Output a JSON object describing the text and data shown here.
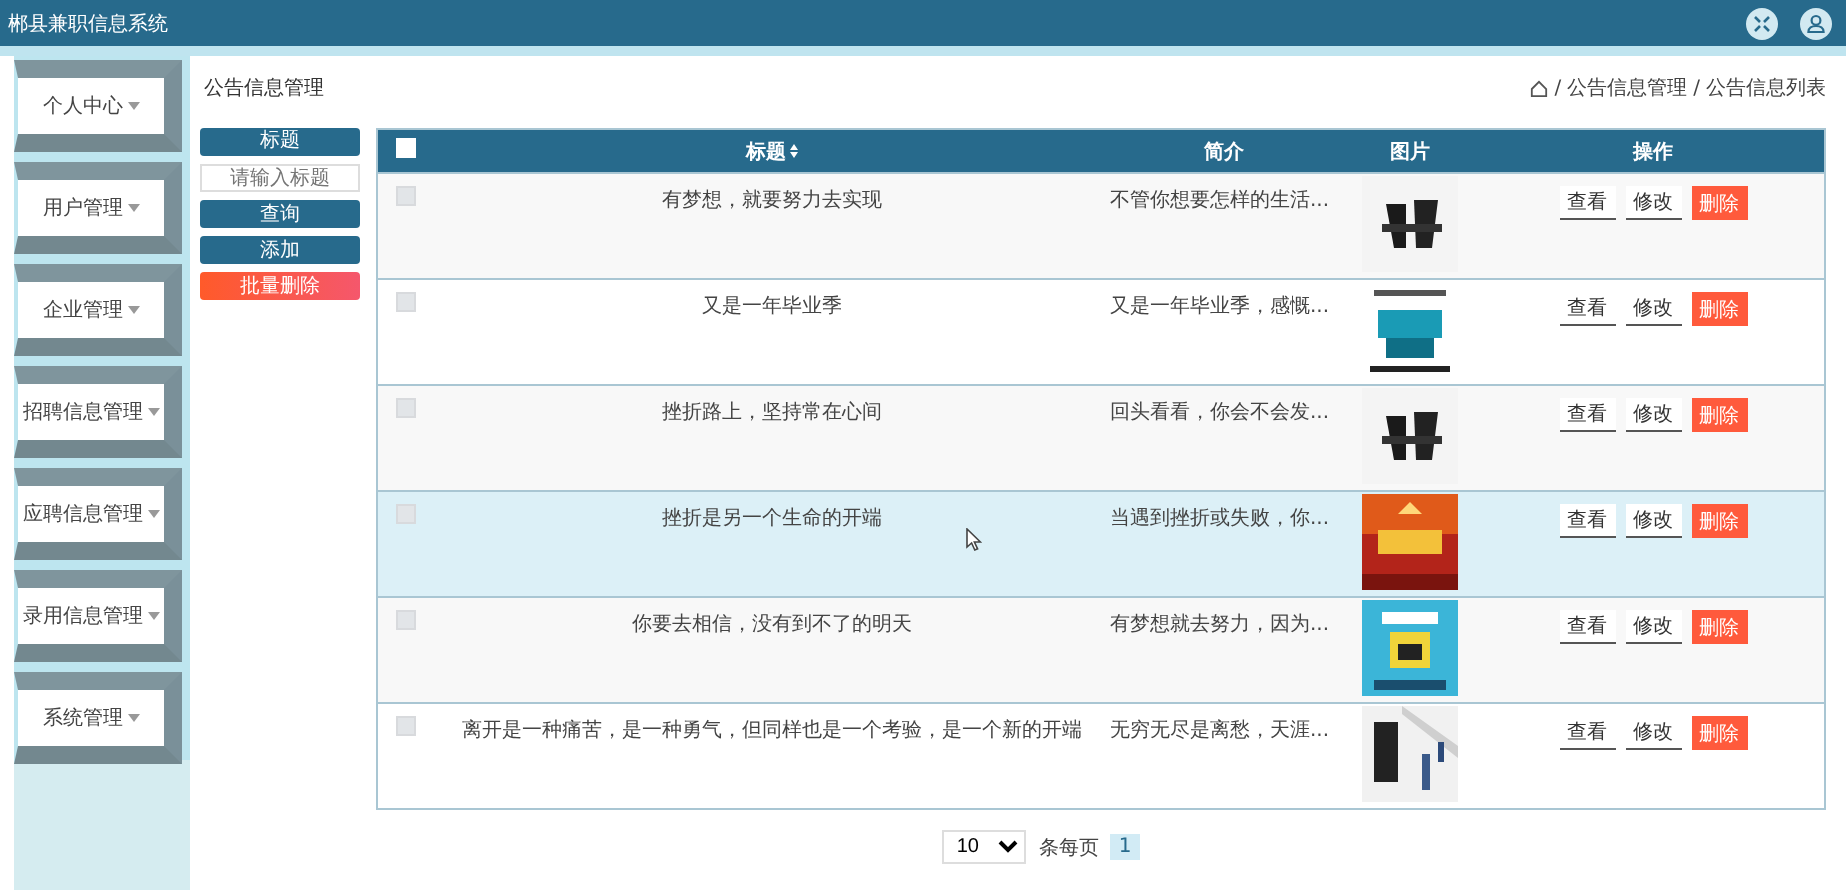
{
  "window": {
    "title": "郴县兼职信息系统"
  },
  "sidebar": {
    "items": [
      {
        "label": "个人中心"
      },
      {
        "label": "用户管理"
      },
      {
        "label": "企业管理"
      },
      {
        "label": "招聘信息管理"
      },
      {
        "label": "应聘信息管理"
      },
      {
        "label": "录用信息管理"
      },
      {
        "label": "系统管理"
      }
    ]
  },
  "page_title": "公告信息管理",
  "breadcrumb": {
    "separator": "/",
    "items": [
      "公告信息管理",
      "公告信息列表"
    ]
  },
  "filter": {
    "label": "标题",
    "placeholder": "请输入标题",
    "buttons": [
      {
        "label": "查询",
        "kind": "primary"
      },
      {
        "label": "添加",
        "kind": "primary"
      },
      {
        "label": "批量删除",
        "kind": "danger"
      }
    ]
  },
  "table": {
    "select_all_checked": false,
    "columns": [
      "标题",
      "简介",
      "图片",
      "操作"
    ],
    "rows": [
      {
        "checked": false,
        "highlighted": false,
        "title": "有梦想，就要努力去实现",
        "summary": "不管你想要怎样的生活...",
        "picture": {
          "kind": "picture"
        },
        "actions": [
          "查看",
          "修改",
          "删除"
        ]
      },
      {
        "checked": false,
        "highlighted": false,
        "title": "又是一年毕业季",
        "summary": "又是一年毕业季，感慨...",
        "picture": {
          "kind": "picture"
        },
        "actions": [
          "查看",
          "修改",
          "删除"
        ]
      },
      {
        "checked": false,
        "highlighted": false,
        "title": "挫折路上，坚持常在心间",
        "summary": "回头看看，你会不会发...",
        "picture": {
          "kind": "picture"
        },
        "actions": [
          "查看",
          "修改",
          "删除"
        ]
      },
      {
        "checked": false,
        "highlighted": true,
        "title": "挫折是另一个生命的开端",
        "summary": "当遇到挫折或失败，你...",
        "picture": {
          "kind": "picture"
        },
        "actions": [
          "查看",
          "修改",
          "删除"
        ]
      },
      {
        "checked": false,
        "highlighted": false,
        "title": "你要去相信，没有到不了的明天",
        "summary": "有梦想就去努力，因为...",
        "picture": {
          "kind": "picture"
        },
        "actions": [
          "查看",
          "修改",
          "删除"
        ]
      },
      {
        "checked": false,
        "highlighted": false,
        "title": "离开是一种痛苦，是一种勇气，但同样也是一个考验，是一个新的开端",
        "summary": "无穷无尽是离愁，天涯...",
        "picture": {
          "kind": "picture"
        },
        "actions": [
          "查看",
          "修改",
          "删除"
        ]
      }
    ]
  },
  "pagination": {
    "page_size": "10",
    "page_size_label": "条每页",
    "pages": [
      {
        "label": "1",
        "selected": true
      }
    ]
  }
}
